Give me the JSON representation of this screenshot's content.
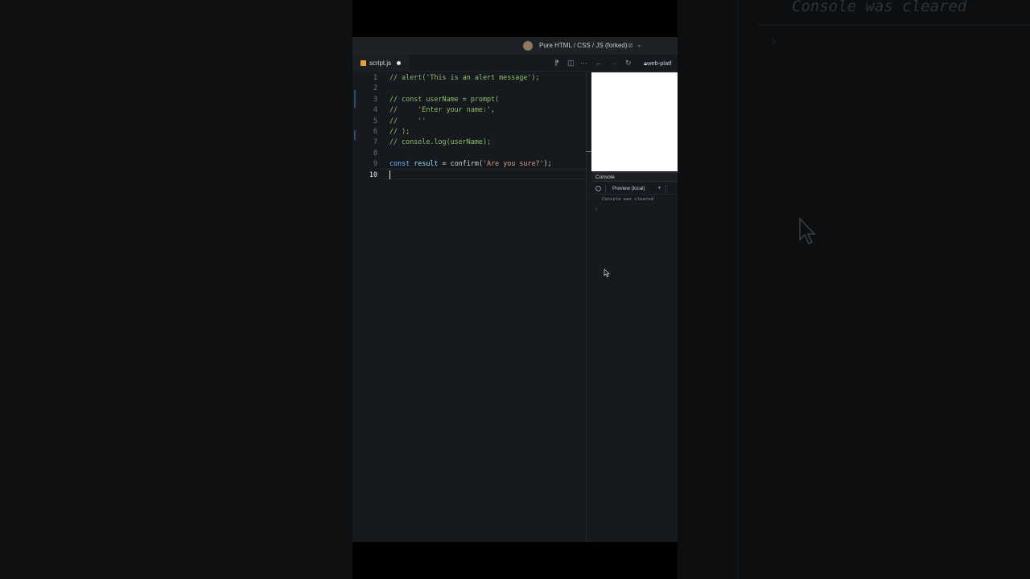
{
  "background": {
    "ghost_console_message": "Console was cleared"
  },
  "titlebar": {
    "project_title": "Pure HTML / CSS / JS (forked)"
  },
  "tabs": [
    {
      "label": "script.js",
      "modified": true
    }
  ],
  "toolbar": {
    "url": "web-platf"
  },
  "editor": {
    "active_line": "10",
    "lines": [
      {
        "n": "1",
        "text": "// alert('This is an alert message');"
      },
      {
        "n": "2",
        "text": ""
      },
      {
        "n": "3",
        "text": "// const userName = prompt("
      },
      {
        "n": "4",
        "text": "//     'Enter your name:',"
      },
      {
        "n": "5",
        "text": "//     ''"
      },
      {
        "n": "6",
        "text": "// );"
      },
      {
        "n": "7",
        "text": "// console.log(userName);"
      },
      {
        "n": "8",
        "text": ""
      },
      {
        "n": "9",
        "tokens": [
          "const",
          " result",
          " = ",
          "confirm(",
          "'Are you sure?'",
          ");"
        ]
      },
      {
        "n": "10",
        "text": ""
      }
    ]
  },
  "console": {
    "title": "Console",
    "context": "Preview (local)",
    "message": "Console was cleared",
    "prompt_symbol": ">"
  }
}
